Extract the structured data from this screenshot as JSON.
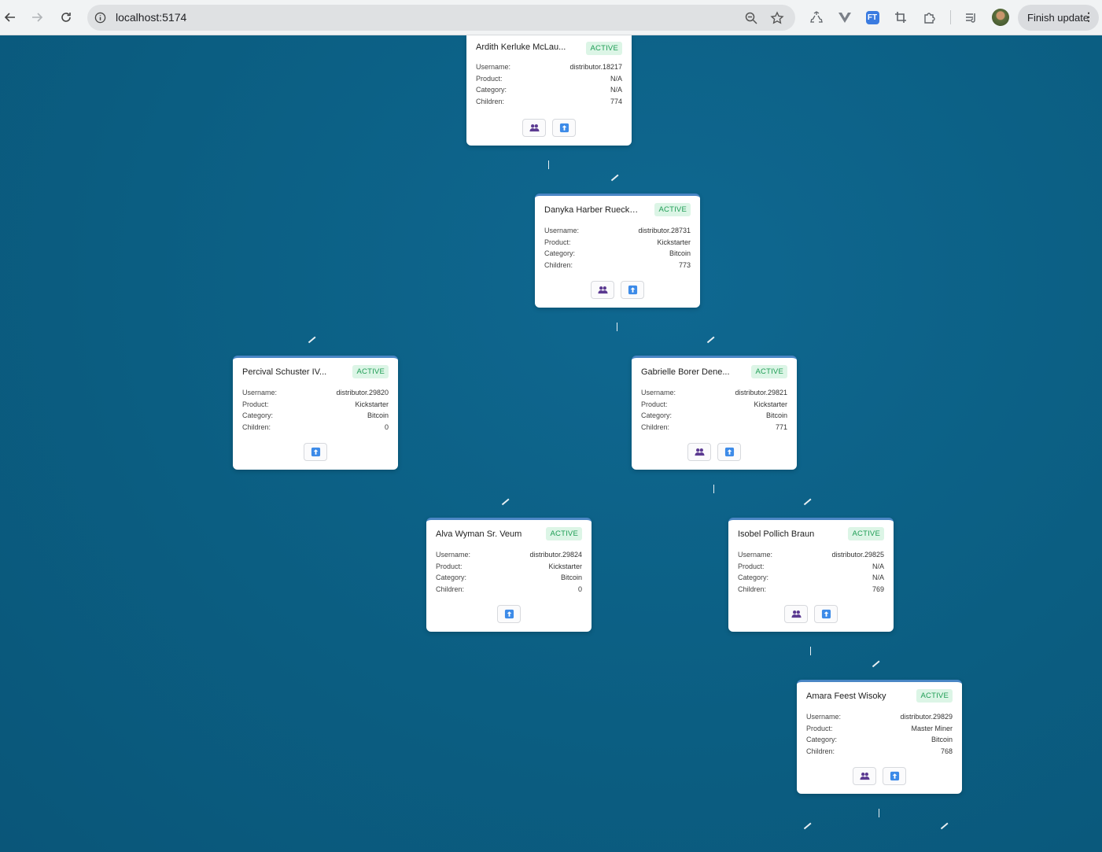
{
  "browser": {
    "url": "localhost:5174",
    "finish_update_label": "Finish update",
    "menu_glyph": "⋮",
    "ext_ft_label": "FT"
  },
  "labels": {
    "username": "Username:",
    "product": "Product:",
    "category": "Category:",
    "children": "Children:"
  },
  "colors": {
    "canvas_bg": "#0b5e82",
    "card_accent": "#4a86c5",
    "badge_bg": "#dcf5e6",
    "badge_text": "#1f9d55",
    "children_icon": "#5b3a91",
    "upload_icon": "#3d8be8"
  },
  "nodes": [
    {
      "name": "Ardith Kerluke McLau...",
      "status": "ACTIVE",
      "username": "distributor.18217",
      "product": "N/A",
      "category": "N/A",
      "children": "774",
      "has_children_button": true
    },
    {
      "name": "Danyka Harber Ruecke...",
      "status": "ACTIVE",
      "username": "distributor.28731",
      "product": "Kickstarter",
      "category": "Bitcoin",
      "children": "773",
      "has_children_button": true
    },
    {
      "name": "Percival Schuster IV...",
      "status": "ACTIVE",
      "username": "distributor.29820",
      "product": "Kickstarter",
      "category": "Bitcoin",
      "children": "0",
      "has_children_button": false
    },
    {
      "name": "Gabrielle Borer Dene...",
      "status": "ACTIVE",
      "username": "distributor.29821",
      "product": "Kickstarter",
      "category": "Bitcoin",
      "children": "771",
      "has_children_button": true
    },
    {
      "name": "Alva Wyman Sr. Veum",
      "status": "ACTIVE",
      "username": "distributor.29824",
      "product": "Kickstarter",
      "category": "Bitcoin",
      "children": "0",
      "has_children_button": false
    },
    {
      "name": "Isobel Pollich Braun",
      "status": "ACTIVE",
      "username": "distributor.29825",
      "product": "N/A",
      "category": "N/A",
      "children": "769",
      "has_children_button": true
    },
    {
      "name": "Amara Feest Wisoky",
      "status": "ACTIVE",
      "username": "distributor.29829",
      "product": "Master Miner",
      "category": "Bitcoin",
      "children": "768",
      "has_children_button": true
    }
  ]
}
